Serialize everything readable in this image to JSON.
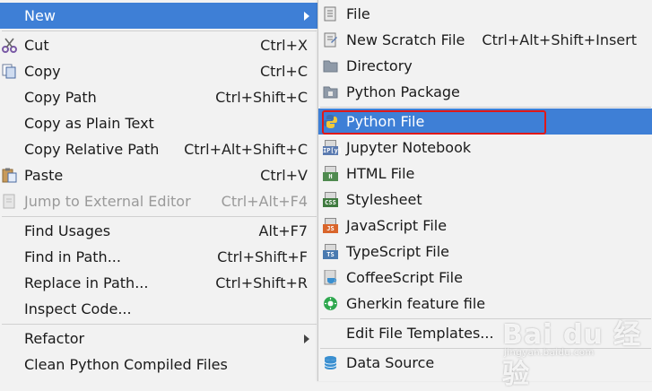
{
  "main_menu": {
    "new": {
      "label": "New"
    },
    "cut": {
      "label": "Cut",
      "shortcut": "Ctrl+X",
      "icon": "scissors-icon"
    },
    "copy": {
      "label": "Copy",
      "shortcut": "Ctrl+C",
      "icon": "copy-icon"
    },
    "copy_path": {
      "label": "Copy Path",
      "shortcut": "Ctrl+Shift+C"
    },
    "copy_plain": {
      "label": "Copy as Plain Text"
    },
    "copy_relative": {
      "label": "Copy Relative Path",
      "shortcut": "Ctrl+Alt+Shift+C"
    },
    "paste": {
      "label": "Paste",
      "shortcut": "Ctrl+V",
      "icon": "paste-icon"
    },
    "jump_external": {
      "label": "Jump to External Editor",
      "shortcut": "Ctrl+Alt+F4"
    },
    "find_usages": {
      "label": "Find Usages",
      "shortcut": "Alt+F7"
    },
    "find_in_path": {
      "label": "Find in Path...",
      "shortcut": "Ctrl+Shift+F"
    },
    "replace_in_path": {
      "label": "Replace in Path...",
      "shortcut": "Ctrl+Shift+R"
    },
    "inspect_code": {
      "label": "Inspect Code..."
    },
    "refactor": {
      "label": "Refactor"
    },
    "clean_compiled": {
      "label": "Clean Python Compiled Files"
    }
  },
  "sub_menu": {
    "file": {
      "label": "File"
    },
    "scratch": {
      "label": "New Scratch File",
      "shortcut": "Ctrl+Alt+Shift+Insert"
    },
    "directory": {
      "label": "Directory"
    },
    "python_package": {
      "label": "Python Package"
    },
    "python_file": {
      "label": "Python File"
    },
    "jupyter": {
      "label": "Jupyter Notebook",
      "badge": "IP[y]"
    },
    "html": {
      "label": "HTML File",
      "badge": "H"
    },
    "stylesheet": {
      "label": "Stylesheet",
      "badge": "CSS"
    },
    "javascript": {
      "label": "JavaScript File",
      "badge": "JS"
    },
    "typescript": {
      "label": "TypeScript File",
      "badge": "TS"
    },
    "coffeescript": {
      "label": "CoffeeScript File"
    },
    "gherkin": {
      "label": "Gherkin feature file"
    },
    "edit_templates": {
      "label": "Edit File Templates..."
    },
    "data_source": {
      "label": "Data Source"
    }
  },
  "colors": {
    "selection": "#3e7fd6",
    "highlight_box": "#e01818",
    "menu_bg": "#f2f2f2"
  },
  "watermark": {
    "big": "Bai du 经验",
    "small": "jingyan.baidu.com"
  }
}
